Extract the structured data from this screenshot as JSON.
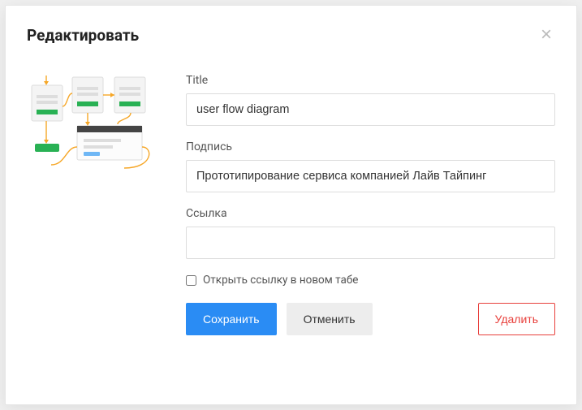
{
  "modal": {
    "title_text": "Редактировать",
    "close_label": "×"
  },
  "fields": {
    "title": {
      "label": "Title",
      "value": "user flow diagram"
    },
    "caption": {
      "label": "Подпись",
      "value": "Прототипирование сервиса компанией Лайв Тайпинг"
    },
    "link": {
      "label": "Ссылка",
      "value": ""
    },
    "open_new_tab": {
      "label": "Открыть ссылку в новом табе",
      "checked": false
    }
  },
  "buttons": {
    "save": "Сохранить",
    "cancel": "Отменить",
    "delete": "Удалить"
  },
  "thumbnail": {
    "alt": "user-flow-diagram-preview"
  }
}
